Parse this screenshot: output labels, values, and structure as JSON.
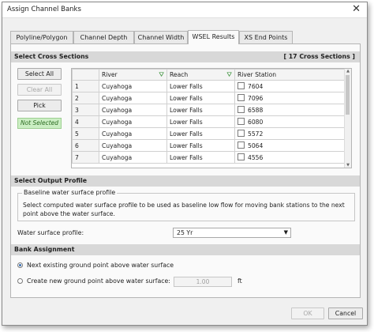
{
  "window": {
    "title": "Assign Channel Banks",
    "close_glyph": "✕"
  },
  "tabs": [
    {
      "label": "Polyline/Polygon",
      "active": false
    },
    {
      "label": "Channel Depth",
      "active": false
    },
    {
      "label": "Channel Width",
      "active": false
    },
    {
      "label": "WSEL Results",
      "active": true
    },
    {
      "label": "XS End Points",
      "active": false
    }
  ],
  "select_cross_sections": {
    "header": "Select Cross Sections",
    "count_label": "[ 17 Cross Sections ]",
    "select_all_label": "Select All",
    "clear_all_label": "Clear All",
    "pick_label": "Pick",
    "status_text": "Not Selected",
    "columns": [
      "",
      "River",
      "Reach",
      "River Station"
    ],
    "rows": [
      {
        "num": "1",
        "river": "Cuyahoga",
        "reach": "Lower Falls",
        "station": "7604",
        "checked": false
      },
      {
        "num": "2",
        "river": "Cuyahoga",
        "reach": "Lower Falls",
        "station": "7096",
        "checked": false
      },
      {
        "num": "3",
        "river": "Cuyahoga",
        "reach": "Lower Falls",
        "station": "6588",
        "checked": false
      },
      {
        "num": "4",
        "river": "Cuyahoga",
        "reach": "Lower Falls",
        "station": "6080",
        "checked": false
      },
      {
        "num": "5",
        "river": "Cuyahoga",
        "reach": "Lower Falls",
        "station": "5572",
        "checked": false
      },
      {
        "num": "6",
        "river": "Cuyahoga",
        "reach": "Lower Falls",
        "station": "5064",
        "checked": false
      },
      {
        "num": "7",
        "river": "Cuyahoga",
        "reach": "Lower Falls",
        "station": "4556",
        "checked": false
      }
    ]
  },
  "select_output_profile": {
    "header": "Select Output Profile",
    "group_title": "Baseline water surface profile",
    "description": "Select computed water surface profile to be used as baseline low flow for moving bank stations to the next point above the water surface.",
    "profile_label": "Water surface profile:",
    "profile_value": "25 Yr"
  },
  "bank_assignment": {
    "header": "Bank Assignment",
    "option1_label": "Next existing ground point above water surface",
    "option1_selected": true,
    "option2_label": "Create new ground point above water surface:",
    "option2_selected": false,
    "value": "1.00",
    "unit": "ft"
  },
  "footer": {
    "ok_label": "OK",
    "cancel_label": "Cancel"
  },
  "colors": {
    "accent": "#3a6fb0",
    "status_bg": "#cbeec3",
    "filter_icon": "#2c8a2c"
  },
  "icons": {
    "filter": "filter-icon",
    "dropdown": "chevron-down-icon",
    "close": "close-icon"
  }
}
